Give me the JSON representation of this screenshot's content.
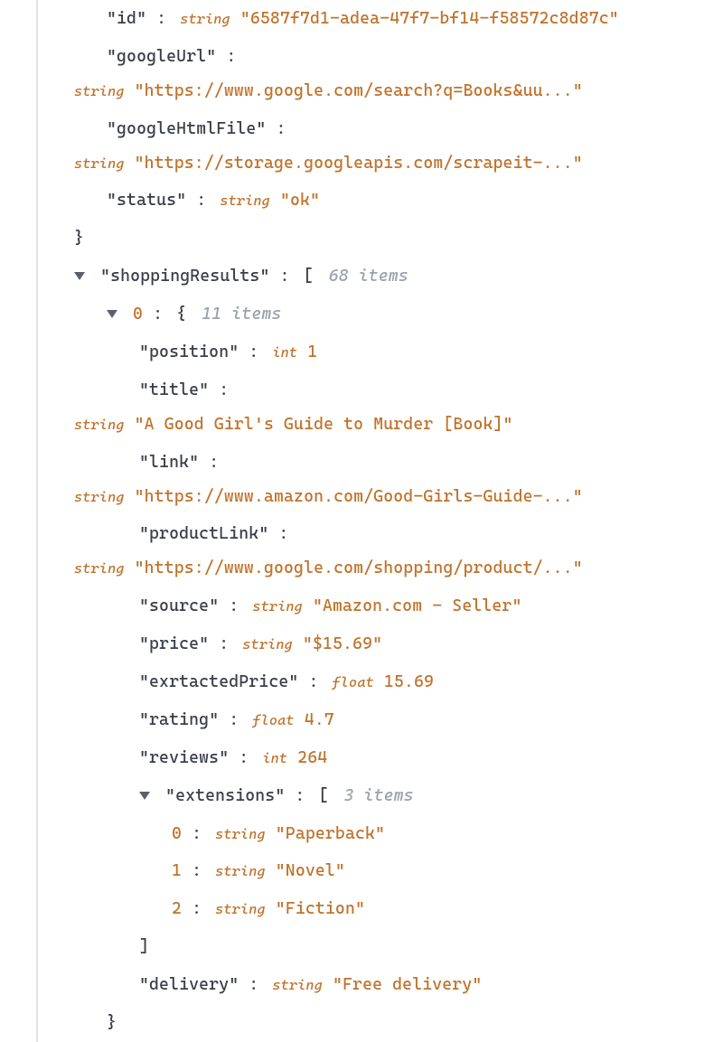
{
  "top": {
    "id_key": "id",
    "id_type": "string",
    "id_val": "\"6587f7d1-adea-47f7-bf14-f58572c8d87c\"",
    "googleUrl_key": "googleUrl",
    "googleUrl_type": "string",
    "googleUrl_val": "\"https://www.google.com/search?q=Books&uu...\"",
    "googleHtmlFile_key": "googleHtmlFile",
    "googleHtmlFile_type": "string",
    "googleHtmlFile_val": "\"https://storage.googleapis.com/scrapeit-...\"",
    "status_key": "status",
    "status_type": "string",
    "status_val": "\"ok\""
  },
  "shoppingResults": {
    "key": "shoppingResults",
    "items_label": "68 items"
  },
  "item0": {
    "idx": "0",
    "items_label": "11 items",
    "position_key": "position",
    "position_type": "int",
    "position_val": "1",
    "title_key": "title",
    "title_type": "string",
    "title_val": "\"A Good Girl's Guide to Murder [Book]\"",
    "link_key": "link",
    "link_type": "string",
    "link_val": "\"https://www.amazon.com/Good-Girls-Guide-...\"",
    "productLink_key": "productLink",
    "productLink_type": "string",
    "productLink_val": "\"https://www.google.com/shopping/product/...\"",
    "source_key": "source",
    "source_type": "string",
    "source_val": "\"Amazon.com - Seller\"",
    "price_key": "price",
    "price_type": "string",
    "price_val": "\"$15.69\"",
    "extractedPrice_key": "exrtactedPrice",
    "extractedPrice_type": "float",
    "extractedPrice_val": "15.69",
    "rating_key": "rating",
    "rating_type": "float",
    "rating_val": "4.7",
    "reviews_key": "reviews",
    "reviews_type": "int",
    "reviews_val": "264",
    "extensions_key": "extensions",
    "extensions_items_label": "3 items",
    "ext0_idx": "0",
    "ext0_type": "string",
    "ext0_val": "\"Paperback\"",
    "ext1_idx": "1",
    "ext1_type": "string",
    "ext1_val": "\"Novel\"",
    "ext2_idx": "2",
    "ext2_type": "string",
    "ext2_val": "\"Fiction\"",
    "delivery_key": "delivery",
    "delivery_type": "string",
    "delivery_val": "\"Free delivery\""
  }
}
